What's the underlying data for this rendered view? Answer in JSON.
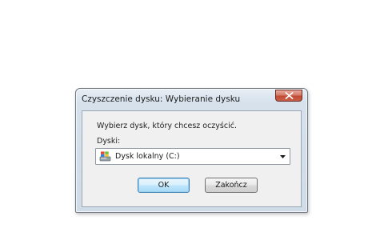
{
  "window": {
    "title": "Czyszczenie dysku: Wybieranie dysku",
    "close_icon": "close-icon"
  },
  "content": {
    "instruction": "Wybierz dysk, który chcesz oczyścić.",
    "drives_label": "Dyski:",
    "drive_select": {
      "selected_value": "Dysk lokalny (C:)",
      "icon": "hard-drive-icon"
    }
  },
  "buttons": {
    "ok_label": "OK",
    "cancel_label": "Zakończ"
  },
  "colors": {
    "close_button": "#c9604a",
    "ok_button_border": "#3c7fb1",
    "frame_tint": "#cfdbe7"
  }
}
